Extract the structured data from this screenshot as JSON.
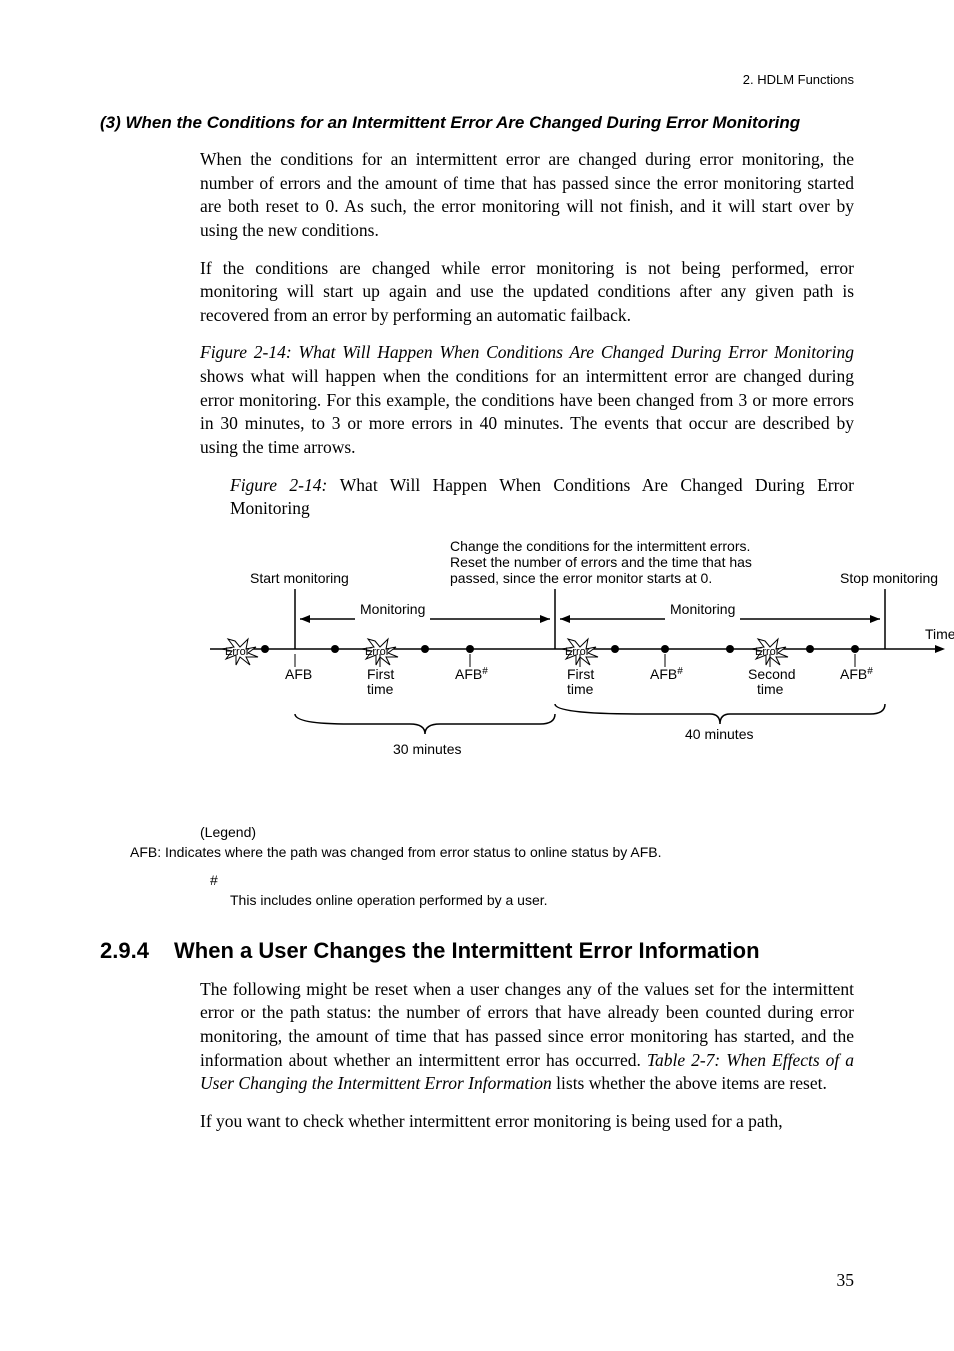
{
  "header": {
    "right": "2. HDLM Functions"
  },
  "section3": {
    "heading": "(3)  When the Conditions for an Intermittent Error Are Changed During Error Monitoring",
    "para1": "When the conditions for an intermittent error are changed during error monitoring, the number of errors and the amount of time that has passed since the error monitoring started are both reset to 0. As such, the error monitoring will not finish, and it will start over by using the new conditions.",
    "para2": "If the conditions are changed while error monitoring is not being performed, error monitoring will start up again and use the updated conditions after any given path is recovered from an error by performing an automatic failback.",
    "para3_prefix_italic": "Figure  2-14:  What Will Happen When Conditions Are Changed During Error Monitoring",
    "para3_rest": " shows what will happen when the conditions for an intermittent error are changed during error monitoring. For this example, the conditions have been changed from 3 or more errors in 30 minutes, to 3 or more errors in 40 minutes. The events that occur are described by using the time arrows.",
    "figcaption_italic": "Figure  2-14:  ",
    "figcaption_rest": "What Will Happen When Conditions Are Changed During Error Monitoring"
  },
  "figure": {
    "topline1": "Change the conditions for the intermittent errors.",
    "topline2": "Reset the number of errors and the time that has",
    "topline3": "passed, since the error monitor starts at 0.",
    "start_monitoring": "Start monitoring",
    "stop_monitoring": "Stop monitoring",
    "monitoring": "Monitoring",
    "time": "Time",
    "error": "Error",
    "afb": "AFB",
    "first_time": "First",
    "first_time2": "time",
    "second_time": "Second",
    "second_time2": "time",
    "afb_hash": "AFB",
    "afb_hash_sup": "#",
    "thirty": "30 minutes",
    "forty": "40 minutes"
  },
  "legend": {
    "label": "(Legend)",
    "afb_desc": "AFB: Indicates where the path was changed from error status to online status by AFB.",
    "hash": "#",
    "hash_desc": "This includes online operation performed by a user."
  },
  "subsection": {
    "number": "2.9.4",
    "title": "When a User Changes the Intermittent Error Information",
    "para1_pre": "The following might be reset when a user changes any of the values set for the intermittent error or the path status: the number of errors that have already been counted during error monitoring, the amount of time that has passed since error monitoring has started, and the information about whether an intermittent error has occurred. ",
    "para1_italic": "Table  2-7:  When Effects of a User Changing the Intermittent Error Information",
    "para1_post": " lists whether the above items are reset.",
    "para2": "If you want to check whether intermittent error monitoring is being used for a path,"
  },
  "page_number": "35"
}
